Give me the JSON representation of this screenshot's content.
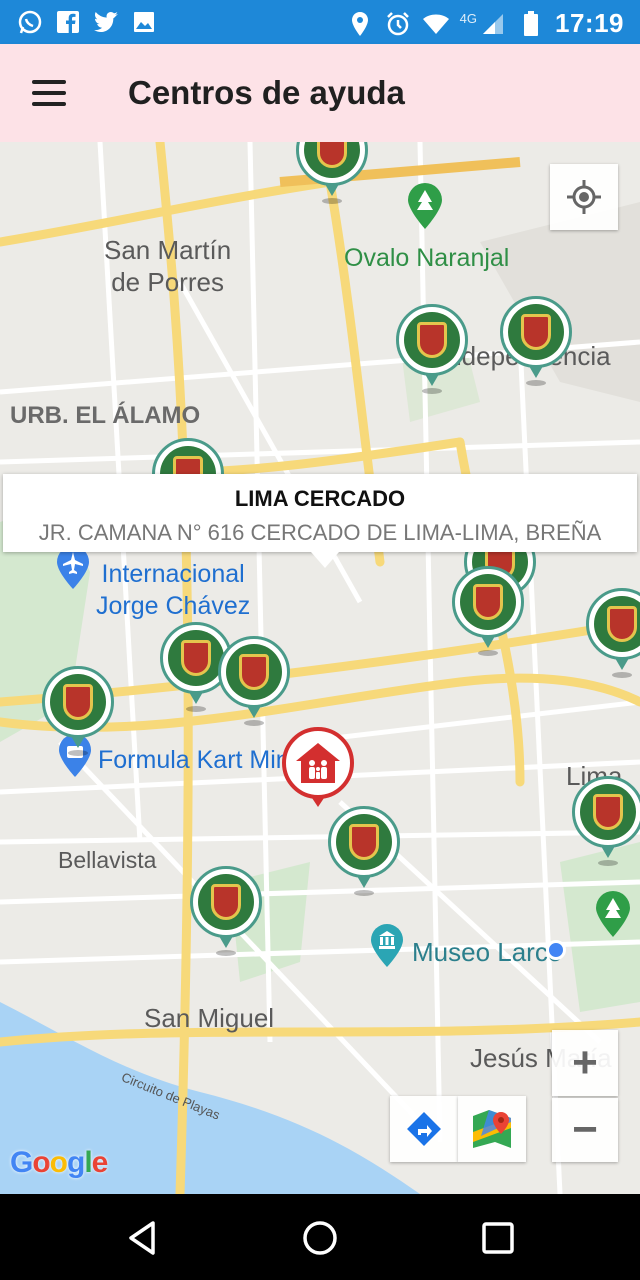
{
  "status_bar": {
    "time": "17:19",
    "network": "4G",
    "left_icons": [
      "whatsapp-icon",
      "facebook-icon",
      "twitter-icon",
      "image-icon"
    ],
    "right_icons": [
      "location-icon",
      "alarm-icon",
      "wifi-icon",
      "signal-icon",
      "battery-icon"
    ],
    "color": "#1e88d8"
  },
  "app_bar": {
    "title": "Centros de ayuda",
    "menu_icon": "hamburger-menu-icon",
    "color": "#fde2e7"
  },
  "map": {
    "places": {
      "san_martin": "San Martín\nde Porres",
      "ovalo": "Ovalo Naranjal",
      "independencia": "Independencia",
      "urb_alamo": "URB. EL ÁLAMO",
      "airport": "Internacional\nJorge Chávez",
      "kart": "Formula Kart Minka",
      "lima": "Lima",
      "bellavista": "Bellavista",
      "museo": "Museo Larco",
      "san_miguel": "San Miguel",
      "jesus_maria": "Jesús María",
      "circuito": "Circuito de Playas"
    },
    "info_window": {
      "title": "LIMA CERCADO",
      "address": "JR. CAMANA N° 616 CERCADO DE LIMA-LIMA, BREÑA"
    },
    "controls": {
      "zoom_in": "+",
      "zoom_out": "−",
      "my_location_icon": "my-location-icon",
      "directions_icon": "directions-icon",
      "google_maps_icon": "google-maps-icon"
    },
    "attribution": "Google",
    "colors": {
      "road_major": "#f7d97a",
      "water": "#a9d3f5",
      "park": "#c8e6c1",
      "police_ring": "#4a9b8a",
      "help_marker": "#d32f2f"
    }
  },
  "nav_bar": {
    "icons": [
      "back-icon",
      "home-icon",
      "recents-icon"
    ]
  }
}
